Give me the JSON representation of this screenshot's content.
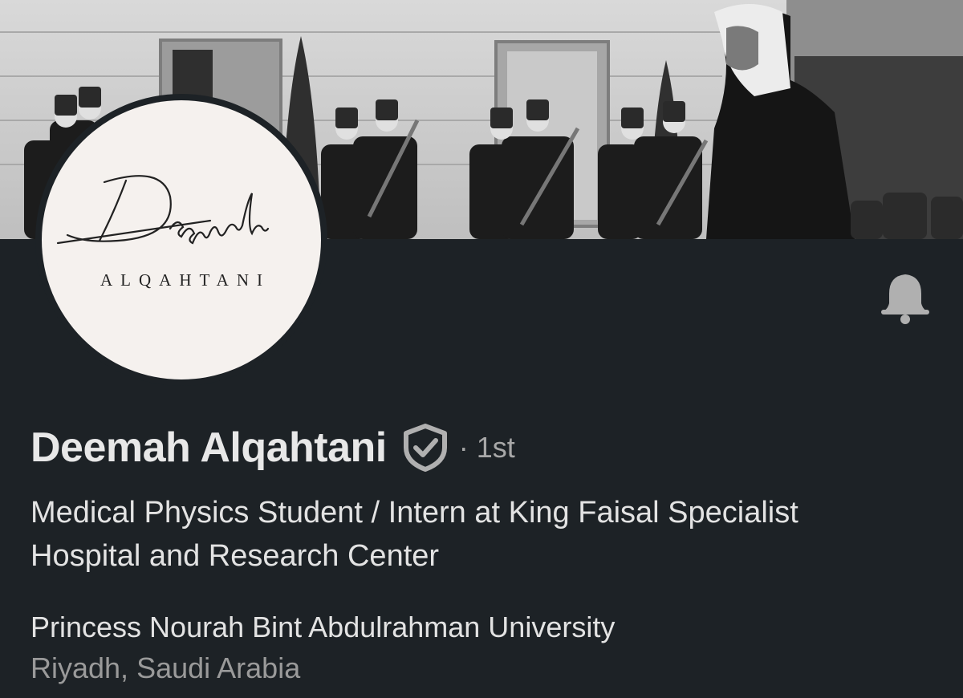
{
  "profile": {
    "name": "Deemah Alqahtani",
    "connection_degree": "· 1st",
    "headline": "Medical Physics Student / Intern at King Faisal Specialist Hospital and Research Center",
    "education": "Princess Nourah Bint Abdulrahman University",
    "location": "Riyadh, Saudi Arabia"
  },
  "avatar": {
    "script_text": "Deemah",
    "sub_text": "ALQAHTANI"
  },
  "icons": {
    "verified": "shield-check-icon",
    "notification": "bell-icon"
  },
  "colors": {
    "background": "#1d2226",
    "text_primary": "#e8e8e8",
    "text_secondary": "#9a9a9a",
    "icon": "#b0b0b0"
  }
}
